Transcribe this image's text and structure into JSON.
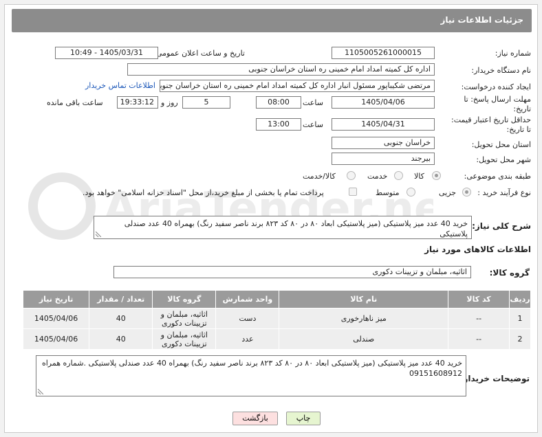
{
  "header": {
    "title": "جزئیات اطلاعات نیاز"
  },
  "fields": {
    "need_number_label": "شماره نیاز:",
    "need_number": "1105005261000015",
    "announce_label": "تاریخ و ساعت اعلان عمومی:",
    "announce_value": "1405/03/31 - 10:49",
    "buyer_org_label": "نام دستگاه خریدار:",
    "buyer_org": "اداره کل کمیته امداد امام خمینی  ره  استان خراسان جنوبی",
    "creator_label": "ایجاد کننده درخواست:",
    "creator": "مرتضی شکیباپور مسئول انبار اداره کل کمیته امداد امام خمینی  ره  استان خراسان جنوبی",
    "contact_link": "اطلاعات تماس خریدار",
    "deadline_label_1": "مهلت ارسال پاسخ: تا",
    "deadline_label_2": "تاریخ:",
    "deadline_date": "1405/04/06",
    "time_word": "ساعت",
    "deadline_time": "08:00",
    "days_count": "5",
    "day_and": "روز و",
    "remaining_time": "19:33:12",
    "remaining_label": "ساعت باقی مانده",
    "validity_label_1": "حداقل تاریخ اعتبار قیمت:",
    "validity_label_2": "تا تاریخ:",
    "validity_date": "1405/04/31",
    "validity_time": "13:00",
    "province_label": "استان محل تحویل:",
    "province": "خراسان جنوبی",
    "city_label": "شهر محل تحویل:",
    "city": "بیرجند",
    "category_label": "طبقه بندی موضوعی:",
    "category_options": [
      "کالا",
      "خدمت",
      "کالا/خدمت"
    ],
    "process_label": "نوع فرآیند خرید :",
    "process_options": [
      "جزیی",
      "متوسط"
    ],
    "payment_note": "پرداخت تمام یا بخشی از مبلغ خرید،از محل \"اسناد خزانه اسلامی\" خواهد بود.",
    "summary_label": "شرح کلی نیاز:",
    "summary": "خرید 40 عدد میز پلاستیکی (میز پلاستیکی ابعاد ۸۰ در ۸۰ کد ۸۲۳ برند ناصر سفید رنگ) بهمراه 40 عدد صندلی پلاستیکی",
    "goods_info_title": "اطلاعات کالاهای مورد نیاز",
    "goods_group_label": "گروه کالا:",
    "goods_group": "اثاثیه، مبلمان و تزیینات دکوری",
    "buyer_notes_label": "توضیحات خریدار:",
    "buyer_notes": "خرید 40 عدد میز پلاستیکی (میز پلاستیکی ابعاد ۸۰ در ۸۰ کد ۸۲۳ برند ناصر سفید رنگ) بهمراه 40 عدد صندلی پلاستیکی .شماره همراه 09151608912"
  },
  "table": {
    "headers": [
      "ردیف",
      "کد کالا",
      "نام کالا",
      "واحد شمارش",
      "گروه کالا",
      "تعداد / مقدار",
      "تاریخ نیاز"
    ],
    "rows": [
      [
        "1",
        "--",
        "میز ناهارخوری",
        "دست",
        "اثاثیه، مبلمان و تزیینات دکوری",
        "40",
        "1405/04/06"
      ],
      [
        "2",
        "--",
        "صندلی",
        "عدد",
        "اثاثیه، مبلمان و تزیینات دکوری",
        "40",
        "1405/04/06"
      ]
    ]
  },
  "buttons": {
    "print": "چاپ",
    "back": "بازگشت"
  },
  "colors": {
    "header_bg": "#8c8c8c",
    "link": "#1a56b8",
    "print_btn": "#e6f5d0",
    "back_btn": "#fde0e0"
  }
}
